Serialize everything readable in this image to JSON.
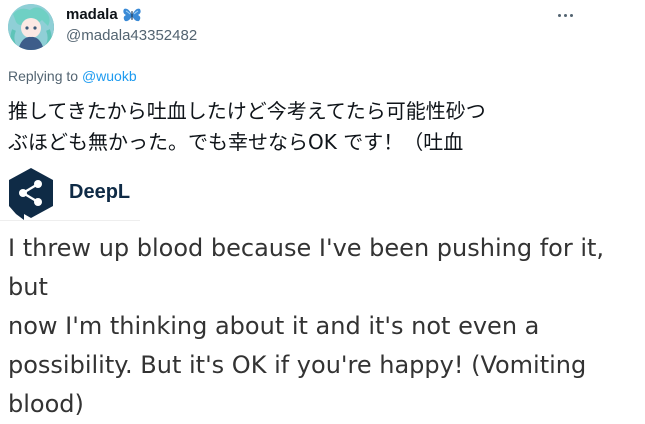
{
  "tweet": {
    "display_name": "madala",
    "badge_icon": "butterfly-icon",
    "handle": "@madala43352482",
    "more_icon": "more-options-icon",
    "replying_label": "Replying to",
    "replying_to": "@wuokb",
    "text_lines": [
      "推してきたから吐血したけど今考えてたら可能性砂つ",
      "ぶほども無かった。でも幸せならOK です！（吐血"
    ]
  },
  "deepl": {
    "logo_icon": "deepl-logo-icon",
    "name": "DeepL",
    "translation_lines": [
      "I threw up blood because I've been pushing for it, but",
      "now I'm thinking about it and it's not even a",
      "possibility. But it's OK if you're happy! (Vomiting",
      "blood)"
    ]
  },
  "colors": {
    "link": "#1d9bf0",
    "secondary_text": "#536471",
    "deepl_navy": "#0f2b46",
    "badge_blue": "#3a8ad6"
  }
}
